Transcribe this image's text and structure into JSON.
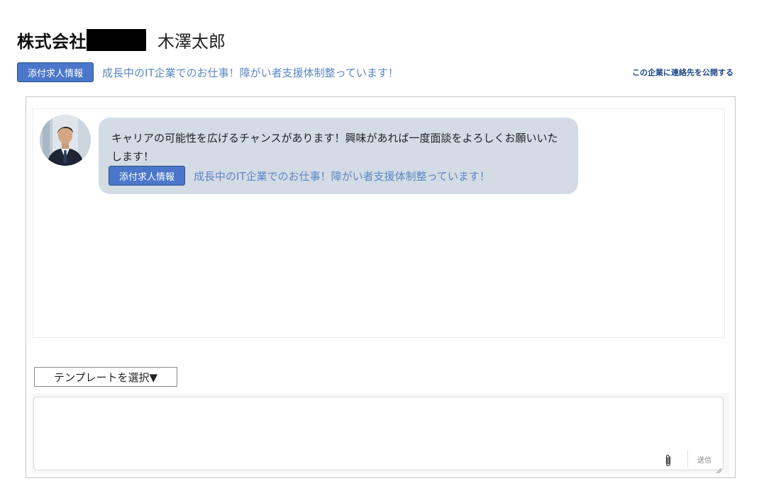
{
  "header": {
    "company_prefix": "株式会社",
    "person_name": "木澤太郎"
  },
  "job": {
    "attach_label": "添付求人情報",
    "job_title": "成長中のIT企業でのお仕事！障がい者支援体制整っています！"
  },
  "actions": {
    "publish_contact": "この企業に連絡先を公開する"
  },
  "chat": {
    "messages": [
      {
        "text": "キャリアの可能性を広げるチャンスがあります！興味があれば一度面談をよろしくお願いいたします！",
        "attach_label": "添付求人情報",
        "job_title": "成長中のIT企業でのお仕事！障がい者支援体制整っています！"
      }
    ]
  },
  "compose": {
    "template_select": "テンプレートを選択▼",
    "placeholder": "",
    "send_label": "送信"
  },
  "colors": {
    "accent_button": "#4a77c9",
    "link": "#5b87c4",
    "bubble_bg": "#d3dbe5",
    "publish_link": "#1f4788"
  },
  "icons": {
    "attachment": "paperclip-icon",
    "avatar": "user-avatar"
  }
}
